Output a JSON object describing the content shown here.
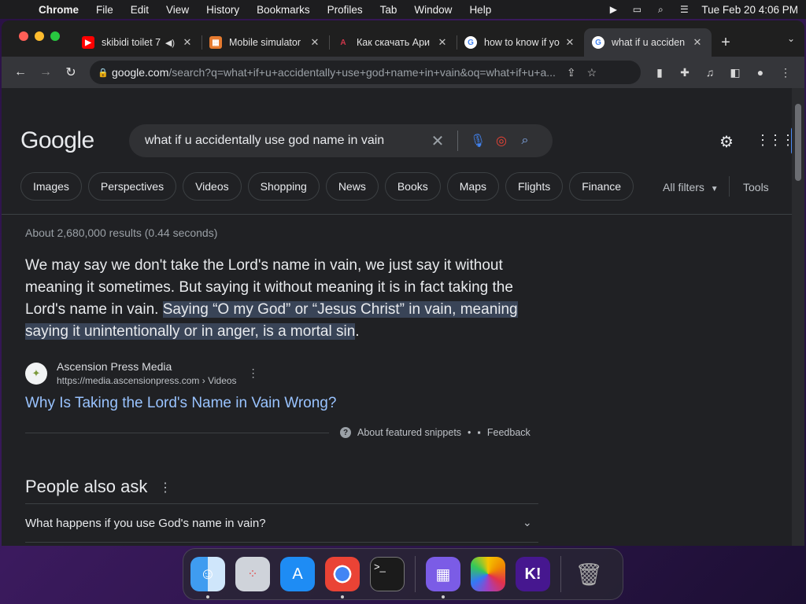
{
  "menubar": {
    "app_name": "Chrome",
    "items": [
      "File",
      "Edit",
      "View",
      "History",
      "Bookmarks",
      "Profiles",
      "Tab",
      "Window",
      "Help"
    ],
    "datetime": "Tue Feb 20  4:06 PM"
  },
  "tabs": [
    {
      "title": "skibidi toilet 7",
      "favicon": "youtube-icon",
      "color": "#ff0000"
    },
    {
      "title": "Mobile simulator",
      "favicon": "mobile-simulator-icon",
      "color": "#e57a2f"
    },
    {
      "title": "Как скачать Ари",
      "favicon": "aristocrat-icon",
      "color": "#d0364a"
    },
    {
      "title": "how to know if yo",
      "favicon": "google-icon",
      "color": "#4285f4"
    },
    {
      "title": "what if u acciden",
      "favicon": "google-icon",
      "color": "#4285f4",
      "active": true
    }
  ],
  "omnibox": {
    "host": "google.com",
    "path": "/search?q=what+if+u+accidentally+use+god+name+in+vain&oq=what+if+u+a..."
  },
  "search": {
    "logo": "Google",
    "query": "what if u accidentally use god name in vain"
  },
  "chips": [
    "Images",
    "Perspectives",
    "Videos",
    "Shopping",
    "News",
    "Books",
    "Maps",
    "Flights",
    "Finance"
  ],
  "filters": {
    "all_filters": "All filters",
    "tools": "Tools"
  },
  "results": {
    "stats": "About 2,680,000 results (0.44 seconds)",
    "snippet_plain": "We may say we don't take the Lord's name in vain, we just say it without meaning it sometimes. But saying it without meaning it is in fact taking the Lord's name in vain. ",
    "snippet_highlight": "Saying “O my God” or “Jesus Christ” in vain, meaning saying it unintentionally or in anger, is a mortal sin",
    "snippet_end": ".",
    "source_name": "Ascension Press Media",
    "source_url": "https://media.ascensionpress.com › Videos",
    "link_title": "Why Is Taking the Lord's Name in Vain Wrong?",
    "about": "About featured snippets",
    "feedback": "Feedback"
  },
  "people_also_ask": {
    "heading": "People also ask",
    "questions": [
      "What happens if you use God's name in vain?"
    ]
  },
  "dock": [
    "finder",
    "launchpad",
    "app-store",
    "chrome",
    "terminal",
    "castle",
    "photos",
    "kahoot",
    "trash"
  ],
  "colors": {
    "accent_link": "#99c3ff",
    "highlight": "#394457",
    "page_bg": "#202124"
  }
}
